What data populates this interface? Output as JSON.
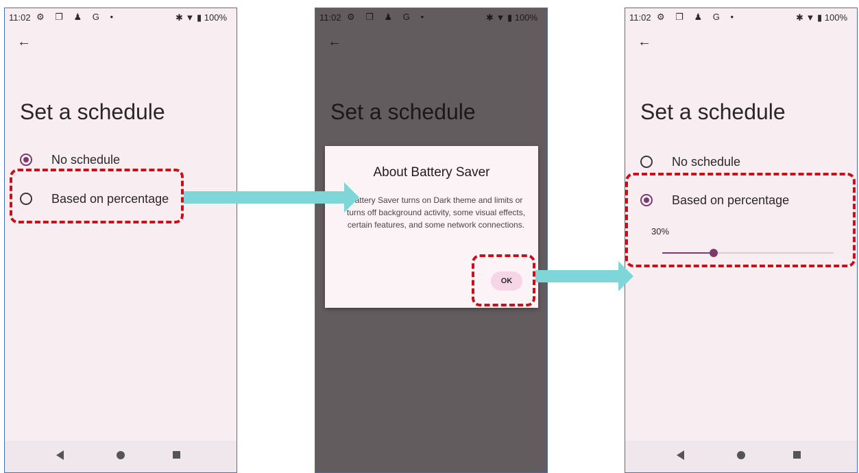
{
  "status": {
    "time": "11:02",
    "icons": "⚙ ❐ ♟ G •",
    "right": "✱ ▼ ▮ 100%"
  },
  "screen": {
    "back_icon": "←",
    "title": "Set a schedule"
  },
  "options": {
    "no_schedule": "No schedule",
    "based_on_percentage": "Based on percentage"
  },
  "dialog": {
    "title": "About Battery Saver",
    "body": "Battery Saver turns on Dark theme and limits or turns off background activity, some visual effects, certain features, and some network connections.",
    "ok_label": "OK"
  },
  "slider": {
    "label": "30%",
    "value": 0.3
  },
  "colors": {
    "accent": "#7a3a6d",
    "highlight": "#c8101a",
    "arrow": "#7fd6d8"
  }
}
